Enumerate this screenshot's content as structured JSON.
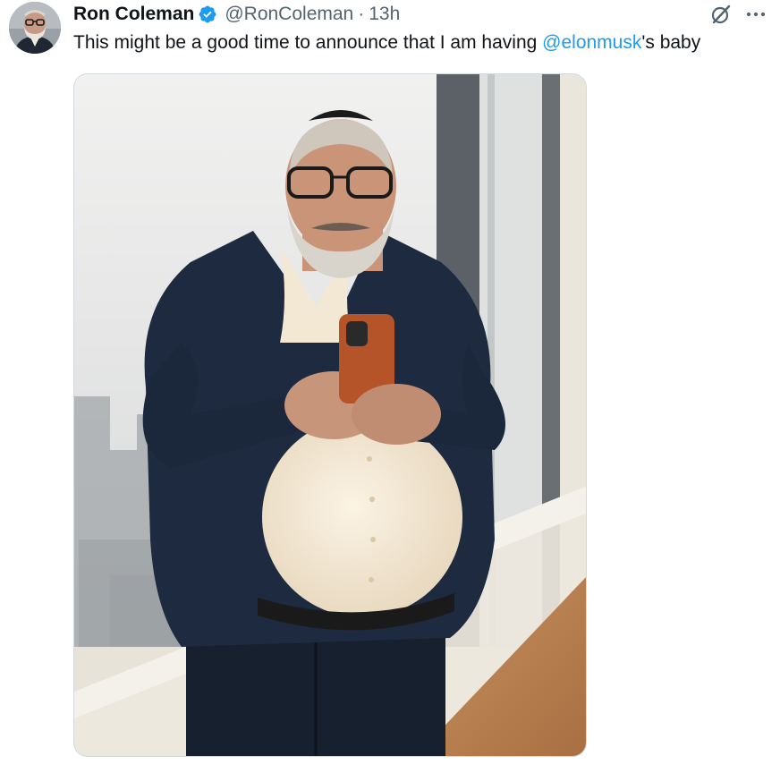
{
  "tweet": {
    "author_name": "Ron Coleman",
    "author_handle": "@RonColeman",
    "separator": "·",
    "time": "13h",
    "text_before": "This might be a good time to announce that I am having ",
    "mention": "@elonmusk",
    "text_after": "'s baby",
    "image_alt": "Image"
  },
  "icons": {
    "verified": "verified-badge-icon",
    "grok": "grok-icon",
    "more": "more-icon"
  },
  "colors": {
    "text": "#0f1419",
    "secondary": "#536471",
    "link": "#1d9bf0",
    "verified": "#1d9bf0"
  }
}
